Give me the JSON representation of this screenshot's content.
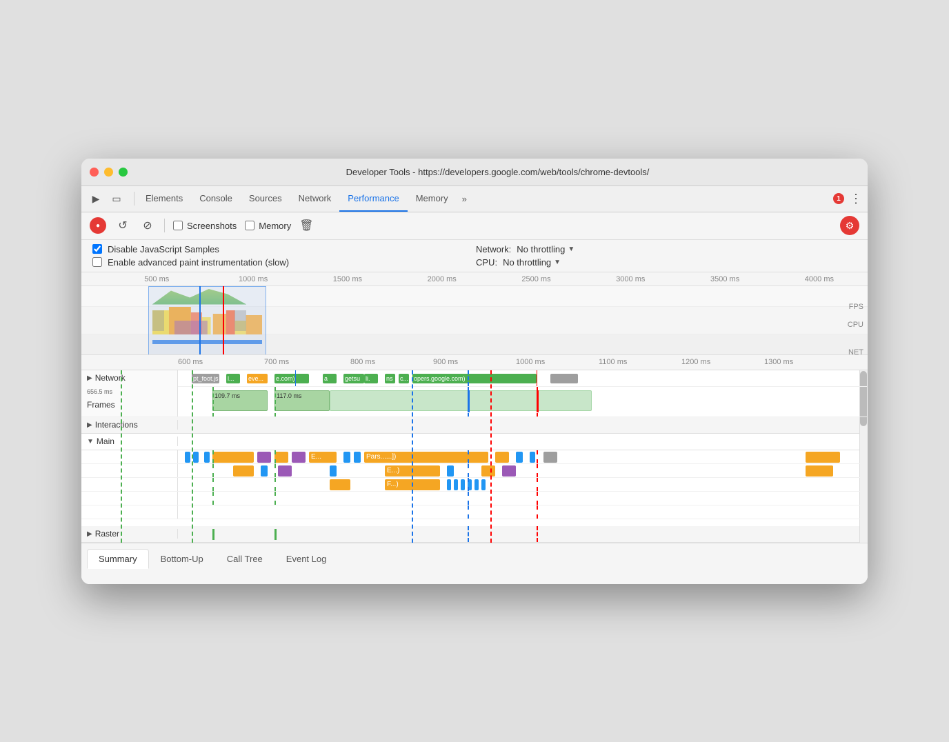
{
  "window": {
    "title": "Developer Tools - https://developers.google.com/web/tools/chrome-devtools/"
  },
  "tabs": {
    "items": [
      {
        "label": "Elements",
        "active": false
      },
      {
        "label": "Console",
        "active": false
      },
      {
        "label": "Sources",
        "active": false
      },
      {
        "label": "Network",
        "active": false
      },
      {
        "label": "Performance",
        "active": true
      },
      {
        "label": "Memory",
        "active": false
      }
    ],
    "overflow_label": "»",
    "error_count": "1"
  },
  "toolbar": {
    "record_tooltip": "Record",
    "reload_tooltip": "Reload",
    "stop_tooltip": "Stop",
    "screenshots_label": "Screenshots",
    "memory_label": "Memory",
    "trash_tooltip": "Clear"
  },
  "options": {
    "disable_js_label": "Disable JavaScript Samples",
    "disable_js_checked": true,
    "adv_paint_label": "Enable advanced paint instrumentation (slow)",
    "adv_paint_checked": false,
    "network_label": "Network:",
    "network_value": "No throttling",
    "cpu_label": "CPU:",
    "cpu_value": "No throttling"
  },
  "overview": {
    "ruler_marks": [
      "500 ms",
      "1000 ms",
      "1500 ms",
      "2000 ms",
      "2500 ms",
      "3000 ms",
      "3500 ms",
      "4000 ms"
    ],
    "fps_label": "FPS",
    "cpu_label": "CPU",
    "net_label": "NET"
  },
  "detail": {
    "ruler_marks": [
      "600 ms",
      "700 ms",
      "800 ms",
      "900 ms",
      "1000 ms",
      "1100 ms",
      "1200 ms",
      "1300 ms"
    ],
    "network_label": "Network",
    "frames_label": "Frames",
    "interactions_label": "Interactions",
    "main_label": "Main",
    "raster_label": "Raster",
    "frames_time1": "109.7 ms",
    "frames_time2": "117.0 ms",
    "frames_badge": "656.5 ms",
    "network_chips": [
      {
        "label": "pt_foot.js",
        "color": "#9e9e9e",
        "left": "3%",
        "width": "5%"
      },
      {
        "label": "l...",
        "color": "#4caf50",
        "left": "10%",
        "width": "3%"
      },
      {
        "label": "eve...",
        "color": "#f5a623",
        "left": "14%",
        "width": "4%"
      },
      {
        "label": "e.com)",
        "color": "#4caf50",
        "left": "19%",
        "width": "6%"
      },
      {
        "label": "a",
        "color": "#4caf50",
        "left": "27%",
        "width": "2%"
      },
      {
        "label": "getsu",
        "color": "#4caf50",
        "left": "30%",
        "width": "3%"
      },
      {
        "label": "li.",
        "color": "#4caf50",
        "left": "34%",
        "width": "2%"
      },
      {
        "label": "ns",
        "color": "#4caf50",
        "left": "37%",
        "width": "2%"
      },
      {
        "label": "c...",
        "color": "#4caf50",
        "left": "40%",
        "width": "2%"
      },
      {
        "label": "opers.google.com)",
        "color": "#4caf50",
        "left": "43%",
        "width": "15%"
      },
      {
        "label": "",
        "color": "#9e9e9e",
        "left": "60%",
        "width": "4%"
      }
    ],
    "main_chips_row1": [
      {
        "label": "",
        "color": "#2196f3",
        "left": "1%",
        "width": "0.5%"
      },
      {
        "label": "",
        "color": "#2196f3",
        "left": "2%",
        "width": "0.5%"
      },
      {
        "label": "",
        "color": "#2196f3",
        "left": "3.5%",
        "width": "0.5%"
      },
      {
        "label": "",
        "color": "#f5a623",
        "left": "5%",
        "width": "6%"
      },
      {
        "label": "",
        "color": "#9b59b6",
        "left": "11.5%",
        "width": "2%"
      },
      {
        "label": "",
        "color": "#f5a623",
        "left": "14%",
        "width": "2%"
      },
      {
        "label": "",
        "color": "#9b59b6",
        "left": "16.5%",
        "width": "2%"
      },
      {
        "label": "E...",
        "color": "#f5a623",
        "left": "19%",
        "width": "4%"
      },
      {
        "label": "",
        "color": "#2196f3",
        "left": "23.5%",
        "width": "1%"
      },
      {
        "label": "",
        "color": "#2196f3",
        "left": "25%",
        "width": "1%"
      },
      {
        "label": "Pars......]) ",
        "color": "#f5a623",
        "left": "27%",
        "width": "14%"
      },
      {
        "label": "",
        "color": "#f5a623",
        "left": "42%",
        "width": "3%"
      },
      {
        "label": "",
        "color": "#f5a623",
        "left": "46%",
        "width": "2%"
      },
      {
        "label": "",
        "color": "#2196f3",
        "left": "49%",
        "width": "1%"
      },
      {
        "label": "",
        "color": "#2196f3",
        "left": "51%",
        "width": "0.5%"
      },
      {
        "label": "",
        "color": "#9e9e9e",
        "left": "53%",
        "width": "2%"
      },
      {
        "label": "",
        "color": "#f5a623",
        "left": "91%",
        "width": "4%"
      }
    ],
    "main_chips_row2": [
      {
        "label": "",
        "color": "#f5a623",
        "left": "8%",
        "width": "3%"
      },
      {
        "label": "",
        "color": "#2196f3",
        "left": "12%",
        "width": "1%"
      },
      {
        "label": "",
        "color": "#9b59b6",
        "left": "14.5%",
        "width": "2%"
      },
      {
        "label": "",
        "color": "#2196f3",
        "left": "21%",
        "width": "1%"
      },
      {
        "label": "E...)",
        "color": "#f5a623",
        "left": "30%",
        "width": "7%"
      },
      {
        "label": "",
        "color": "#2196f3",
        "left": "38%",
        "width": "1%"
      },
      {
        "label": "",
        "color": "#f5a623",
        "left": "44%",
        "width": "2%"
      },
      {
        "label": "",
        "color": "#9b59b6",
        "left": "47%",
        "width": "2%"
      },
      {
        "label": "",
        "color": "#f5a623",
        "left": "91%",
        "width": "3%"
      }
    ],
    "main_chips_row3": [
      {
        "label": "",
        "color": "#f5a623",
        "left": "22%",
        "width": "3%"
      },
      {
        "label": "F...)",
        "color": "#f5a623",
        "left": "30%",
        "width": "7%"
      },
      {
        "label": "",
        "color": "#2196f3",
        "left": "38%",
        "width": "0.5%"
      },
      {
        "label": "",
        "color": "#2196f3",
        "left": "39%",
        "width": "0.5%"
      },
      {
        "label": "",
        "color": "#2196f3",
        "left": "40%",
        "width": "0.5%"
      },
      {
        "label": "",
        "color": "#2196f3",
        "left": "41%",
        "width": "0.5%"
      },
      {
        "label": "",
        "color": "#2196f3",
        "left": "42%",
        "width": "0.5%"
      },
      {
        "label": "",
        "color": "#2196f3",
        "left": "43%",
        "width": "0.5%"
      }
    ]
  },
  "bottom_tabs": {
    "items": [
      {
        "label": "Summary",
        "active": true
      },
      {
        "label": "Bottom-Up",
        "active": false
      },
      {
        "label": "Call Tree",
        "active": false
      },
      {
        "label": "Event Log",
        "active": false
      }
    ]
  }
}
